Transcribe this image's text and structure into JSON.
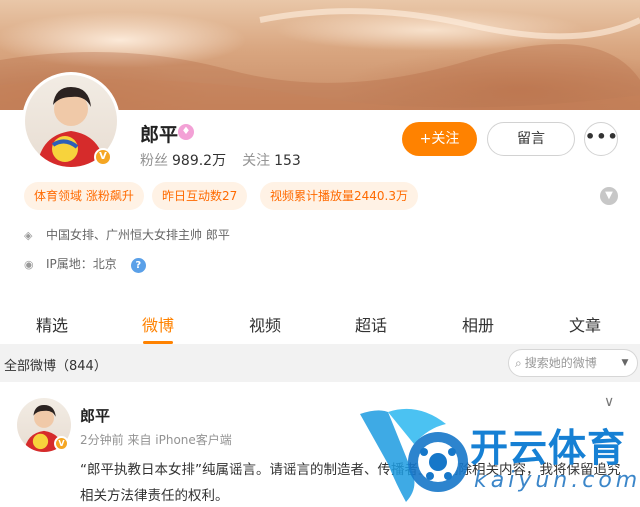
{
  "profile": {
    "name": "郎平",
    "fans_label": "粉丝",
    "fans_count": "989.2万",
    "following_label": "关注",
    "following_count": "153",
    "follow_button": "+关注",
    "message_button": "留言",
    "more_button": "•••"
  },
  "tags": [
    {
      "text": "体育领域 涨粉飙升"
    },
    {
      "text": "昨日互动数27"
    },
    {
      "text": "视频累计播放量2440.3万"
    }
  ],
  "info": {
    "description": "中国女排、广州恒大女排主帅 郎平",
    "ip_location": "IP属地：北京"
  },
  "tabs": [
    "精选",
    "微博",
    "视频",
    "超话",
    "相册",
    "文章"
  ],
  "active_tab": "微博",
  "filter": {
    "label": "全部微博（844）",
    "search_placeholder": "搜索她的微博"
  },
  "post": {
    "author": "郎平",
    "meta": "2分钟前  来自 iPhone客户端",
    "text": "“郎平执教日本女排”纯属谣言。请谣言的制造者、传播者立即删除相关内容，我将保留追究相关方法律责任的权利。"
  },
  "watermark": {
    "brand_cn": "开云体育",
    "brand_en": "kaiyun.com"
  },
  "colors": {
    "accent": "#ff8200",
    "tag_bg": "#fff2e5",
    "tag_text": "#ff6a00",
    "watermark_blue": "#1680d4"
  }
}
